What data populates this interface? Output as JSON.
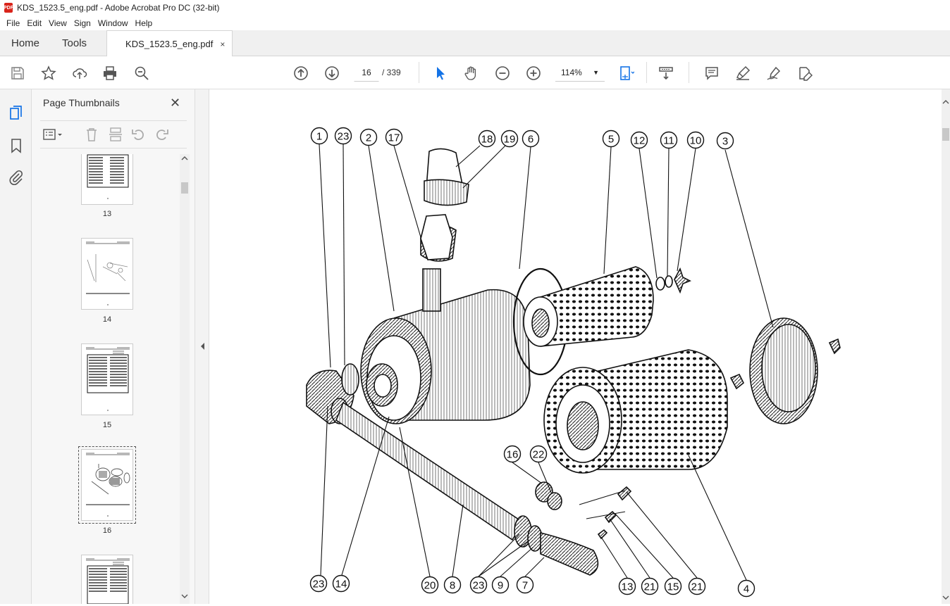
{
  "window": {
    "title": "KDS_1523.5_eng.pdf - Adobe Acrobat Pro DC (32-bit)",
    "app_icon_label": "PDF"
  },
  "menu": [
    "File",
    "Edit",
    "View",
    "Sign",
    "Window",
    "Help"
  ],
  "tabs": {
    "home": "Home",
    "tools": "Tools",
    "document": "KDS_1523.5_eng.pdf",
    "close": "×"
  },
  "toolbar": {
    "current_page": "16",
    "total_pages": "/ 339",
    "zoom": "114%",
    "icons": [
      "save-icon",
      "bookmark-star-icon",
      "upload-icon",
      "print-icon",
      "find-zoom-icon",
      "prev-page-icon",
      "next-page-icon",
      "select-cursor-icon",
      "hand-icon",
      "zoom-out-icon",
      "zoom-in-icon",
      "fit-page-icon",
      "scroll-mode-icon",
      "comment-icon",
      "highlight-icon",
      "sign-icon",
      "edit-pdf-icon"
    ]
  },
  "sidebar": {
    "title": "Page Thumbnails",
    "close": "✕",
    "thumbnails": [
      {
        "label": "13",
        "selected": false
      },
      {
        "label": "14",
        "selected": false
      },
      {
        "label": "15",
        "selected": false
      },
      {
        "label": "16",
        "selected": true
      },
      {
        "label": "",
        "selected": false
      }
    ]
  },
  "drawing": {
    "callouts": [
      "1",
      "23",
      "2",
      "17",
      "18",
      "19",
      "6",
      "5",
      "12",
      "11",
      "10",
      "3",
      "16",
      "22",
      "23",
      "14",
      "20",
      "8",
      "23",
      "9",
      "7",
      "13",
      "21",
      "15",
      "21",
      "4"
    ]
  }
}
